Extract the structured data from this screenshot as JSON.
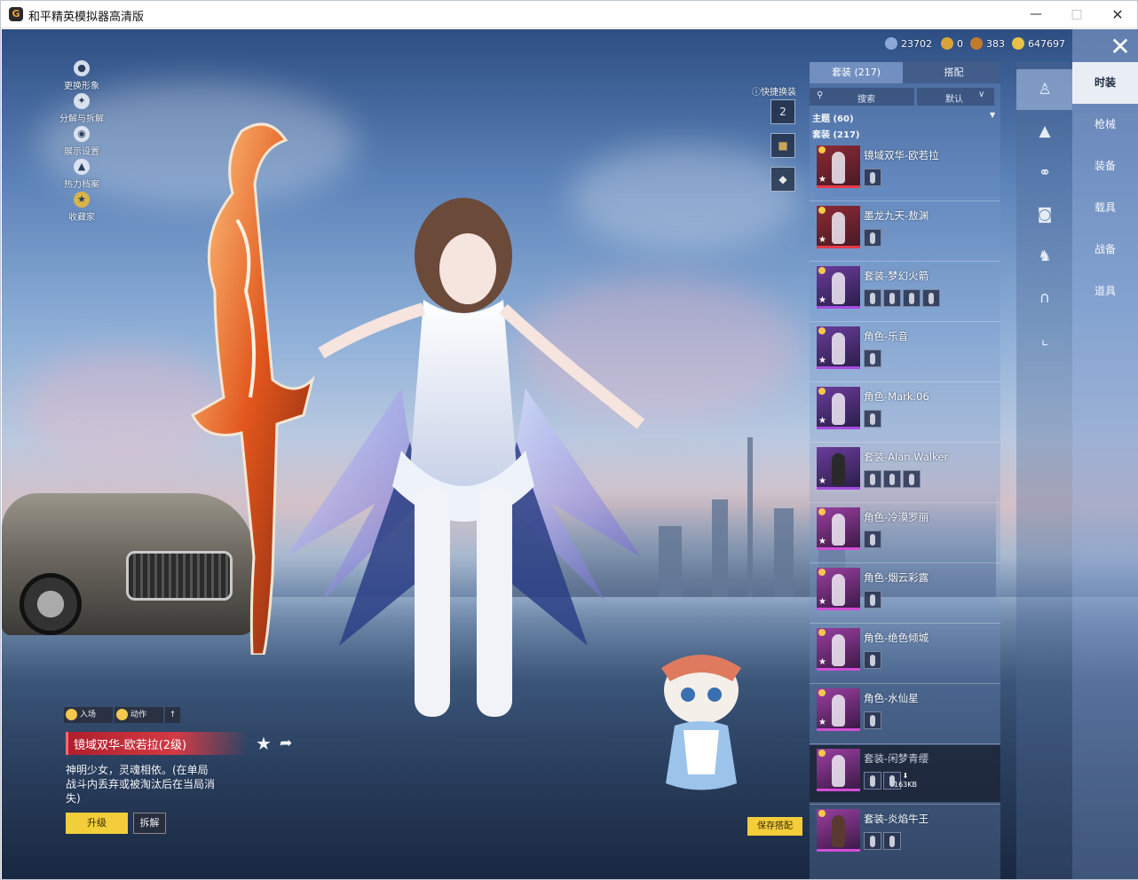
{
  "window": {
    "title": "和平精英模拟器高清版",
    "icon_letter": "G"
  },
  "currency": [
    {
      "icon": "crystal-currency-icon",
      "value": "23702",
      "color": "#8aa8d8"
    },
    {
      "icon": "gold-coin-icon",
      "value": "0",
      "color": "#d9a43a"
    },
    {
      "icon": "bronze-coin-icon",
      "value": "383",
      "color": "#c07b2d"
    },
    {
      "icon": "bp-coin-icon",
      "value": "647697",
      "color": "#e8c04a"
    }
  ],
  "left_menu": [
    {
      "label": "更换形象",
      "icon": "person-icon"
    },
    {
      "label": "分解与拆解",
      "icon": "puzzle-icon"
    },
    {
      "label": "展示设置",
      "icon": "eye-icon"
    },
    {
      "label": "热力档案",
      "icon": "flame-icon"
    },
    {
      "label": "收藏家",
      "icon": "collector-badge-icon"
    }
  ],
  "quick_change": {
    "label": "快捷换装",
    "slots": [
      "2",
      "",
      ""
    ]
  },
  "inventory": {
    "tabs": [
      "套装 (217)",
      "搭配"
    ],
    "search_label": "搜索",
    "sort_label": "默认",
    "group_theme": "主题 (60)",
    "group_suits": "套装 (217)",
    "items": [
      {
        "name": "镜域双华-欧若拉",
        "rarity": "red",
        "parts": 1
      },
      {
        "name": "墨龙九天-敖渊",
        "rarity": "red",
        "parts": 1
      },
      {
        "name": "套装-梦幻火箭",
        "rarity": "purple",
        "parts": 4
      },
      {
        "name": "角色-乐音",
        "rarity": "purple",
        "parts": 1
      },
      {
        "name": "角色-Mark.06",
        "rarity": "purple",
        "parts": 1
      },
      {
        "name": "套装-Alan Walker",
        "rarity": "purple",
        "parts": 3
      },
      {
        "name": "角色-冷漠罗丽",
        "rarity": "magenta",
        "parts": 1
      },
      {
        "name": "角色-烟云彩露",
        "rarity": "magenta",
        "parts": 1
      },
      {
        "name": "角色-绝色倾城",
        "rarity": "magenta",
        "parts": 1
      },
      {
        "name": "角色-水仙星",
        "rarity": "magenta",
        "parts": 1
      },
      {
        "name": "套装-闲梦青缨",
        "rarity": "magenta",
        "parts": 2,
        "download": "163KB"
      },
      {
        "name": "套装-炎焰牛王",
        "rarity": "magenta",
        "parts": 2
      }
    ]
  },
  "categories": [
    "outfit-icon",
    "cap-icon",
    "goggles-icon",
    "mask-icon",
    "body-icon",
    "pants-icon",
    "shoes-icon"
  ],
  "right_nav": [
    "时装",
    "枪械",
    "装备",
    "载具",
    "战备",
    "道具"
  ],
  "bottom": {
    "entrance_label": "入场",
    "action_label": "动作",
    "title": "镜域双华-欧若拉(2级)",
    "description": "神明少女，灵魂相依。(在单局战斗内丢弃或被淘汰后在当局消失)",
    "upgrade_label": "升级",
    "dismantle_label": "拆解",
    "save_label": "保存搭配"
  }
}
